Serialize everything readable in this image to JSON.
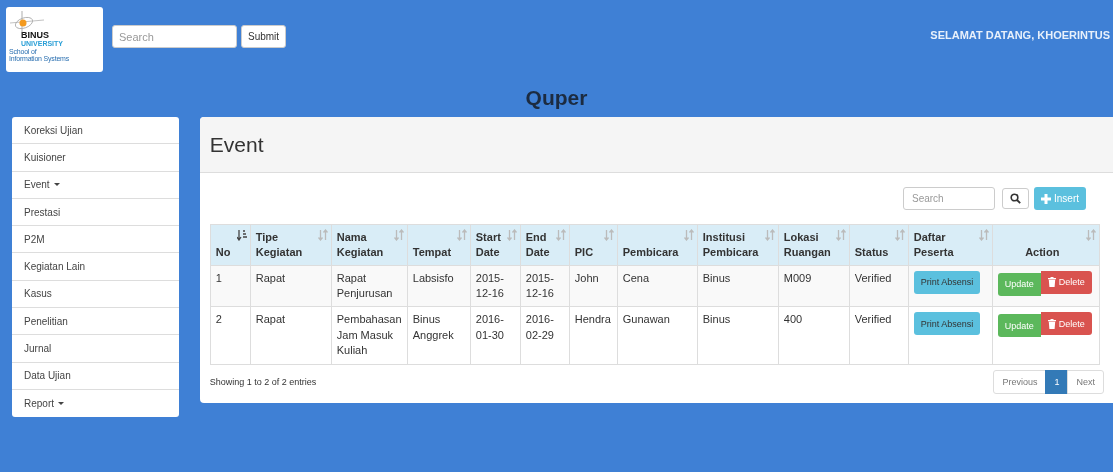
{
  "logo": {
    "name": "BINUS",
    "line_1": "UNIVERSITY",
    "line_2": "School of",
    "line_3": "Information Systems"
  },
  "search": {
    "placeholder": "Search"
  },
  "submit": "Submit",
  "greeting": "SELAMAT DATANG, KHOERINTUS",
  "app_title": "Quper",
  "sidebar": {
    "items": [
      {
        "label": "Koreksi Ujian",
        "dropdown": false
      },
      {
        "label": "Kuisioner",
        "dropdown": false
      },
      {
        "label": "Event",
        "dropdown": true
      },
      {
        "label": "Prestasi",
        "dropdown": false
      },
      {
        "label": "P2M",
        "dropdown": false
      },
      {
        "label": "Kegiatan Lain",
        "dropdown": false
      },
      {
        "label": "Kasus",
        "dropdown": false
      },
      {
        "label": "Penelitian",
        "dropdown": false
      },
      {
        "label": "Jurnal",
        "dropdown": false
      },
      {
        "label": "Data Ujian",
        "dropdown": false
      },
      {
        "label": "Report",
        "dropdown": true
      }
    ]
  },
  "panel": {
    "title": "Event",
    "search": {
      "placeholder": "Search"
    },
    "insert": "Insert"
  },
  "table": {
    "columns": [
      {
        "label": "No",
        "sorted": true
      },
      {
        "label": "Tipe Kegiatan",
        "sorted": false
      },
      {
        "label": "Nama Kegiatan",
        "sorted": false
      },
      {
        "label": "Tempat",
        "sorted": false
      },
      {
        "label": "Start Date",
        "sorted": false
      },
      {
        "label": "End Date",
        "sorted": false
      },
      {
        "label": "PIC",
        "sorted": false
      },
      {
        "label": "Pembicara",
        "sorted": false
      },
      {
        "label": "Institusi Pembicara",
        "sorted": false
      },
      {
        "label": "Lokasi Ruangan",
        "sorted": false
      },
      {
        "label": "Status",
        "sorted": false
      },
      {
        "label": "Daftar Peserta",
        "sorted": false
      },
      {
        "label": "Action",
        "sorted": false
      }
    ],
    "rows": [
      {
        "cells": [
          "1",
          "Rapat",
          "Rapat Penjurusan",
          "Labsisfo",
          "2015-12-16",
          "2015-12-16",
          "John",
          "Cena",
          "Binus",
          "M009",
          "Verified"
        ],
        "print": "Print Absensi",
        "update": "Update",
        "delete": "Delete"
      },
      {
        "cells": [
          "2",
          "Rapat",
          "Pembahasan Jam Masuk Kuliah",
          "Binus Anggrek",
          "2016-01-30",
          "2016-02-29",
          "Hendra",
          "Gunawan",
          "Binus",
          "400",
          "Verified"
        ],
        "print": "Print Absensi",
        "update": "Update",
        "delete": "Delete"
      }
    ]
  },
  "info": "Showing 1 to 2 of 2 entries",
  "pagination": {
    "previous": "Previous",
    "pages": [
      {
        "label": "1",
        "selected": true
      }
    ],
    "next": "Next"
  }
}
